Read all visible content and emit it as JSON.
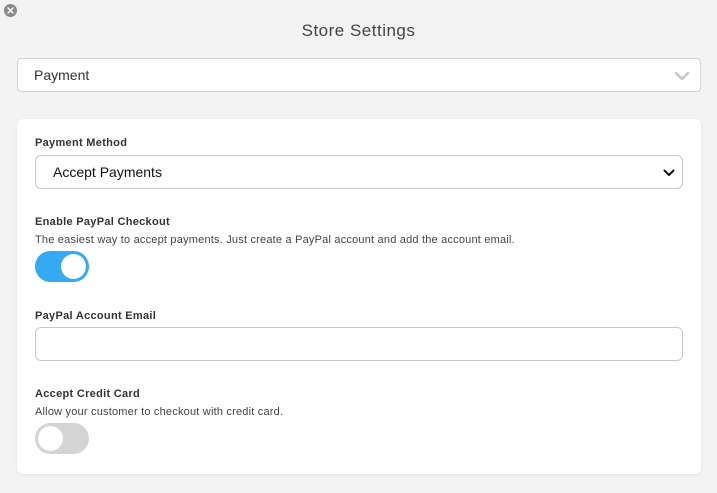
{
  "dialog": {
    "title": "Store Settings",
    "close_icon": "close-icon"
  },
  "section_selector": {
    "selected": "Payment",
    "icon": "chevron-down-icon"
  },
  "payment_method": {
    "label": "Payment Method",
    "selected": "Accept Payments",
    "icon": "chevron-down-icon"
  },
  "paypal_checkout": {
    "label": "Enable PayPal Checkout",
    "description": "The easiest way to accept payments. Just create a PayPal account and add the account email.",
    "enabled": true,
    "color_on": "#33aaf2"
  },
  "paypal_email": {
    "label": "PayPal Account Email",
    "value": "",
    "placeholder": ""
  },
  "credit_card": {
    "label": "Accept Credit Card",
    "description": "Allow your customer to checkout with credit card.",
    "enabled": false,
    "color_off": "#d4d4d4"
  }
}
